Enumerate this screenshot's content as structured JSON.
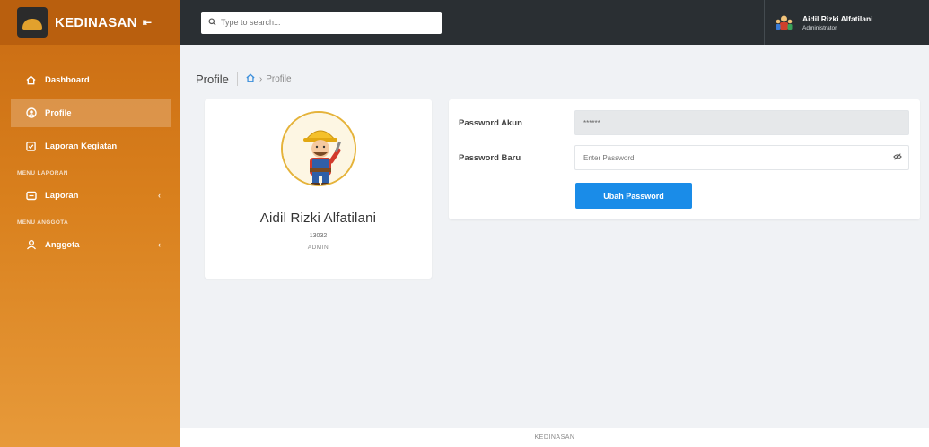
{
  "brand": {
    "name": "KEDINASAN",
    "toggle": "⇤"
  },
  "sidebar": {
    "items": [
      {
        "label": "Dashboard",
        "icon": "home-icon"
      },
      {
        "label": "Profile",
        "icon": "profile-icon",
        "active": true
      },
      {
        "label": "Laporan Kegiatan",
        "icon": "checklist-icon"
      }
    ],
    "section_laporan": {
      "heading": "MENU LAPORAN",
      "item": {
        "label": "Laporan",
        "icon": "report-icon"
      }
    },
    "section_anggota": {
      "heading": "MENU ANGGOTA",
      "item": {
        "label": "Anggota",
        "icon": "user-icon"
      }
    }
  },
  "topbar": {
    "search_placeholder": "Type to search...",
    "user_name": "Aidil Rizki Alfatilani",
    "user_role": "Administrator"
  },
  "page": {
    "title": "Profile",
    "breadcrumb": "Profile"
  },
  "profile": {
    "name": "Aidil Rizki Alfatilani",
    "nik": "13032",
    "role": "ADMIN"
  },
  "password_form": {
    "current_label": "Password Akun",
    "current_value": "******",
    "new_label": "Password Baru",
    "new_placeholder": "Enter Password",
    "submit_label": "Ubah Password"
  },
  "footer": {
    "text": "KEDINASAN"
  },
  "colors": {
    "sidebar": "#d9801d",
    "topbar": "#2a2f33",
    "primary_button": "#1a8ce8",
    "breadcrumb_home": "#3a8edb"
  }
}
